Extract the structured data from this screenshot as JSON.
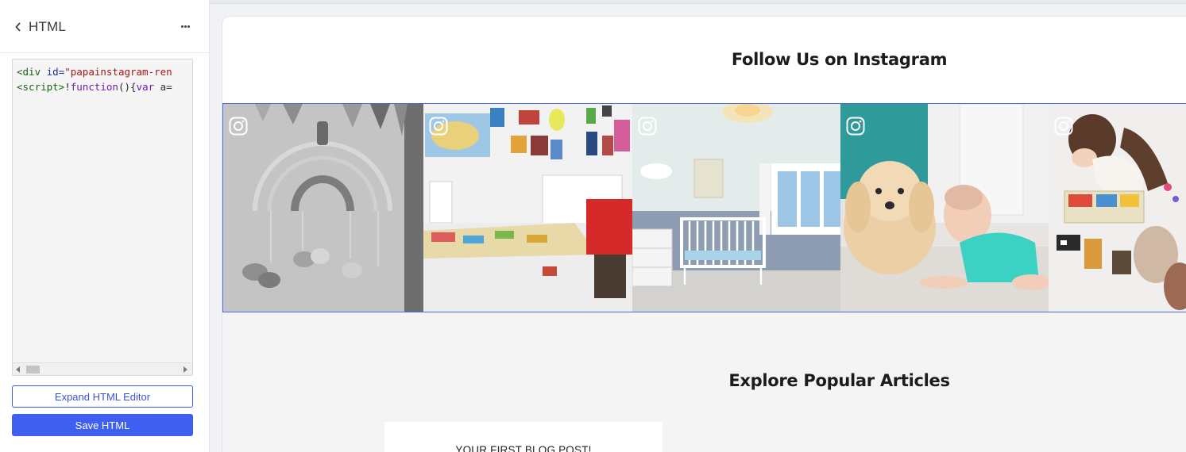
{
  "editor": {
    "title": "HTML",
    "code_lines": [
      [
        {
          "t": "tag",
          "v": "<div "
        },
        {
          "t": "attr",
          "v": "id="
        },
        {
          "t": "str",
          "v": "\"papainstagram-ren"
        }
      ],
      [
        {
          "t": "tag",
          "v": "<script>"
        },
        {
          "t": "plain",
          "v": "!"
        },
        {
          "t": "kw",
          "v": "function"
        },
        {
          "t": "plain",
          "v": "(){"
        },
        {
          "t": "kw",
          "v": "var"
        },
        {
          "t": "plain",
          "v": " a="
        }
      ]
    ],
    "expand_label": "Expand HTML Editor",
    "save_label": "Save HTML"
  },
  "preview": {
    "instagram_heading": "Follow Us on Instagram",
    "articles_heading": "Explore Popular Articles",
    "blog_card_title": "YOUR FIRST BLOG POST!",
    "gallery": [
      {
        "name": "nursery-mobile-photo"
      },
      {
        "name": "playroom-photo"
      },
      {
        "name": "nursery-crib-photo"
      },
      {
        "name": "puppy-and-baby-photo"
      },
      {
        "name": "toddler-with-toys-photo"
      }
    ]
  },
  "colors": {
    "accent": "#3f5ff0",
    "gallery_border": "#4a6be0"
  },
  "icons": [
    "chevron-left-icon",
    "more-dots-icon",
    "instagram-icon"
  ]
}
